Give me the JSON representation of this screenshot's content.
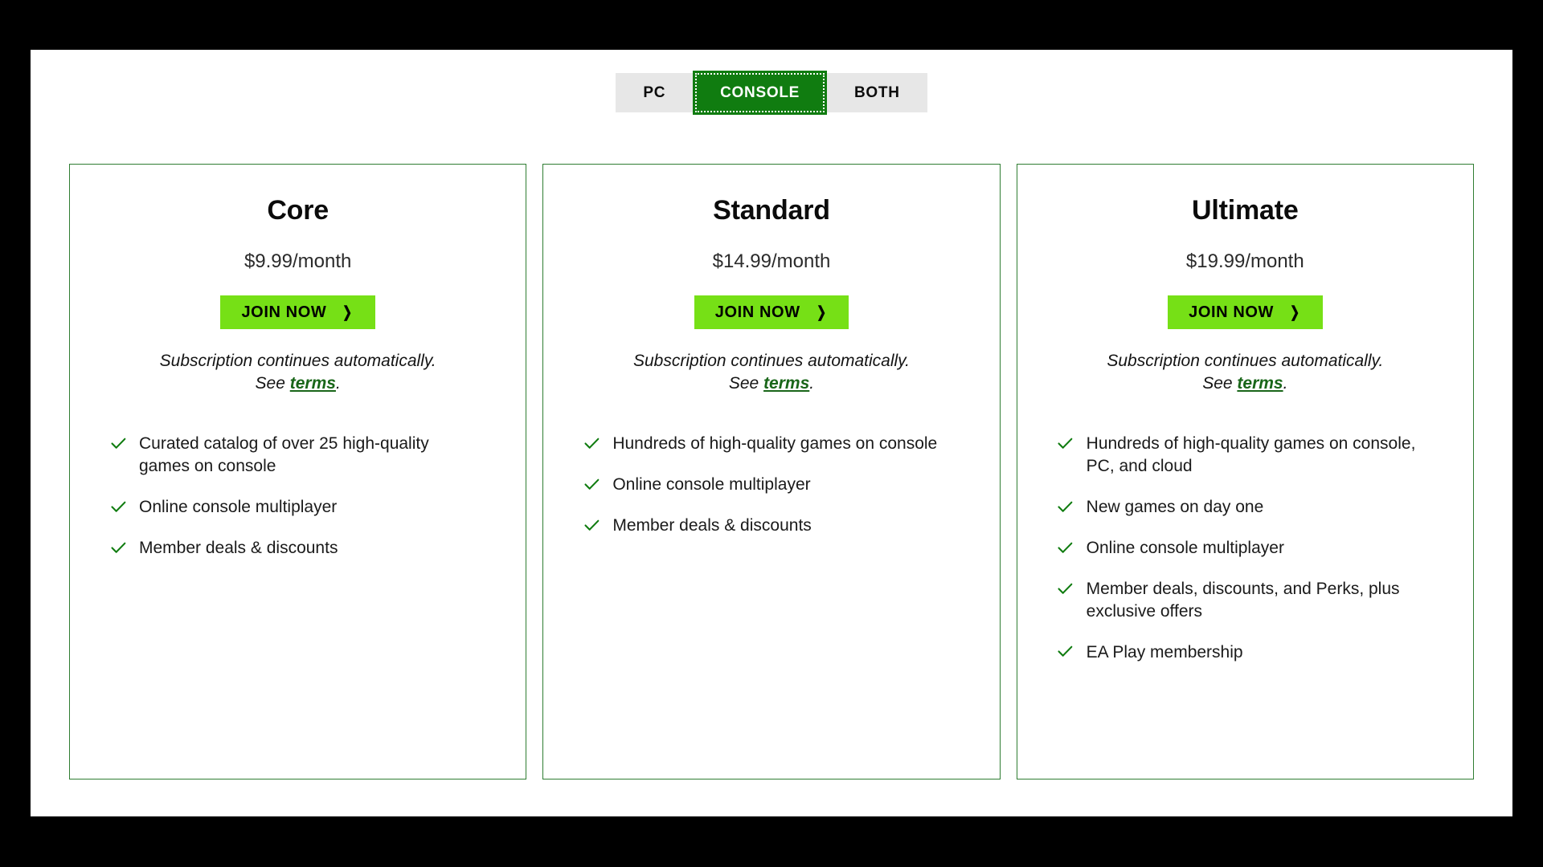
{
  "platform_toggle": {
    "name": "platform-selector",
    "options": [
      {
        "label": "PC",
        "active": false
      },
      {
        "label": "CONSOLE",
        "active": true
      },
      {
        "label": "BOTH",
        "active": false
      }
    ],
    "selected": "CONSOLE"
  },
  "colors": {
    "active_toggle_green": "#107C10",
    "inactive_toggle_gray": "#E7E7E7",
    "join_button_green": "#76E016",
    "card_border_green": "#2F7D32",
    "link_green": "#196619",
    "check_green": "#107C10",
    "page_background": "#FFFFFF",
    "letterbox": "#000000"
  },
  "terms_common": {
    "line1": "Subscription continues automatically.",
    "line2_prefix": "See ",
    "link_label": "terms",
    "line2_suffix": "."
  },
  "join_button": {
    "label": "JOIN NOW",
    "chevron": "❯"
  },
  "plans": [
    {
      "title": "Core",
      "price": "$9.99/month",
      "features": [
        "Curated catalog of over 25 high-quality games on console",
        "Online console multiplayer",
        "Member deals & discounts"
      ]
    },
    {
      "title": "Standard",
      "price": "$14.99/month",
      "features": [
        "Hundreds of high-quality games on console",
        "Online console multiplayer",
        "Member deals & discounts"
      ]
    },
    {
      "title": "Ultimate",
      "price": "$19.99/month",
      "features": [
        "Hundreds of high-quality games on console, PC, and cloud",
        "New games on day one",
        "Online console multiplayer",
        "Member deals, discounts, and Perks, plus exclusive offers",
        "EA Play membership"
      ]
    }
  ]
}
